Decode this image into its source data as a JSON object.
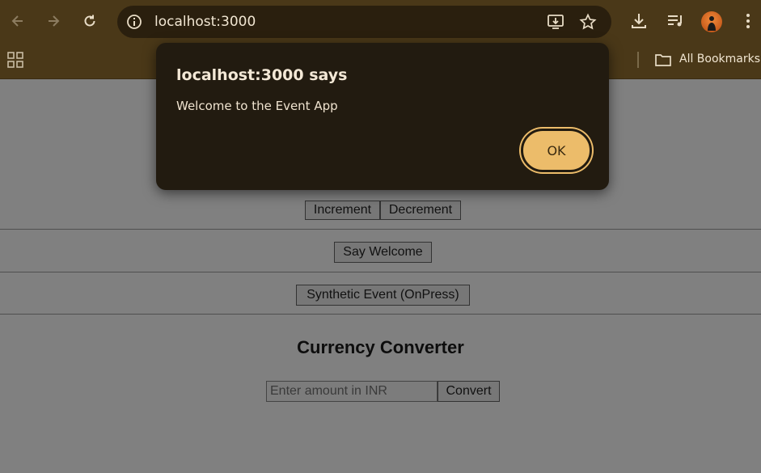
{
  "browser": {
    "url": "localhost:3000",
    "bookmarks_label": "All Bookmarks",
    "icons": [
      "back-arrow-icon",
      "forward-arrow-icon",
      "reload-icon",
      "site-info-icon",
      "install-app-icon",
      "star-icon",
      "download-icon",
      "media-controls-icon",
      "avatar",
      "menu-dots-icon",
      "apps-grid-icon",
      "folder-icon"
    ]
  },
  "page": {
    "increment_label": "Increment",
    "decrement_label": "Decrement",
    "say_welcome_label": "Say Welcome",
    "synthetic_event_label": "Synthetic Event (OnPress)",
    "currency_heading": "Currency Converter",
    "amount_placeholder": "Enter amount in INR",
    "convert_label": "Convert"
  },
  "dialog": {
    "title": "localhost:3000 says",
    "message": "Welcome to the Event App",
    "ok_label": "OK"
  },
  "colors": {
    "chrome_bg": "#4a3818",
    "dialog_bg": "#221b10",
    "ok_button": "#ecbc6a",
    "page_bg": "#808080"
  }
}
